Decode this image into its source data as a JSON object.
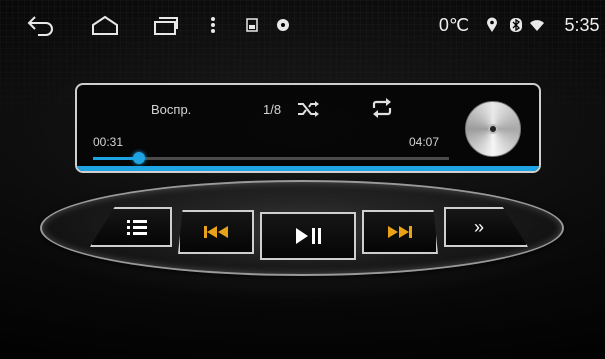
{
  "statusbar": {
    "temperature": "0℃",
    "time": "5:35",
    "icons": [
      "back-icon",
      "home-icon",
      "recents-icon",
      "menu-icon",
      "sd-card-icon",
      "music-indicator-icon",
      "location-icon",
      "bluetooth-icon",
      "wifi-icon"
    ]
  },
  "player": {
    "status_label": "Воспр.",
    "track_counter": "1/8",
    "elapsed": "00:31",
    "duration": "04:07",
    "progress_fraction": 0.13
  },
  "controls": {
    "items": [
      "playlist",
      "previous",
      "play-pause",
      "next",
      "more"
    ],
    "accent": "#e8a21a"
  },
  "colors": {
    "accent": "#1ea3e3",
    "frame": "#cfcfcf"
  }
}
